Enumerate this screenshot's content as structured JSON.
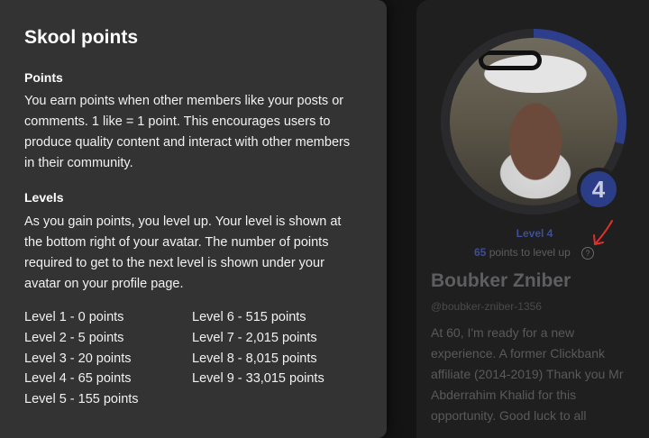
{
  "popover": {
    "title": "Skool points",
    "points_heading": "Points",
    "points_body": "You earn points when other members like your posts or comments. 1 like = 1 point. This encourages users to produce quality content and interact with other members in their community.",
    "levels_heading": "Levels",
    "levels_body": "As you gain points, you level up. Your level is shown at the bottom right of your avatar. The number of points required to get to the next level is shown under your avatar on your profile page.",
    "levels_col1": [
      "Level 1 - 0 points",
      "Level 2 - 5 points",
      "Level 3 - 20 points",
      "Level 4 - 65 points",
      "Level 5 - 155 points"
    ],
    "levels_col2": [
      "Level 6 - 515 points",
      "Level 7 - 2,015 points",
      "Level 8 - 8,015 points",
      "Level 9 - 33,015 points"
    ]
  },
  "profile": {
    "level_badge": "4",
    "level_label": "Level 4",
    "level_progress": 0.29,
    "points_needed": "65",
    "points_suffix": " points to level up",
    "help_icon": "?",
    "name": "Boubker Zniber",
    "handle": "@boubker-zniber-1356",
    "bio": "At 60, I'm ready for a new experience. A former Clickbank affiliate (2014-2019) Thank you Mr Abderrahim Khalid for this opportunity. Good luck to all"
  },
  "colors": {
    "popover_bg": "#333334",
    "level_accent": "#2b3d86",
    "annotation_arrow": "#e0302a"
  }
}
